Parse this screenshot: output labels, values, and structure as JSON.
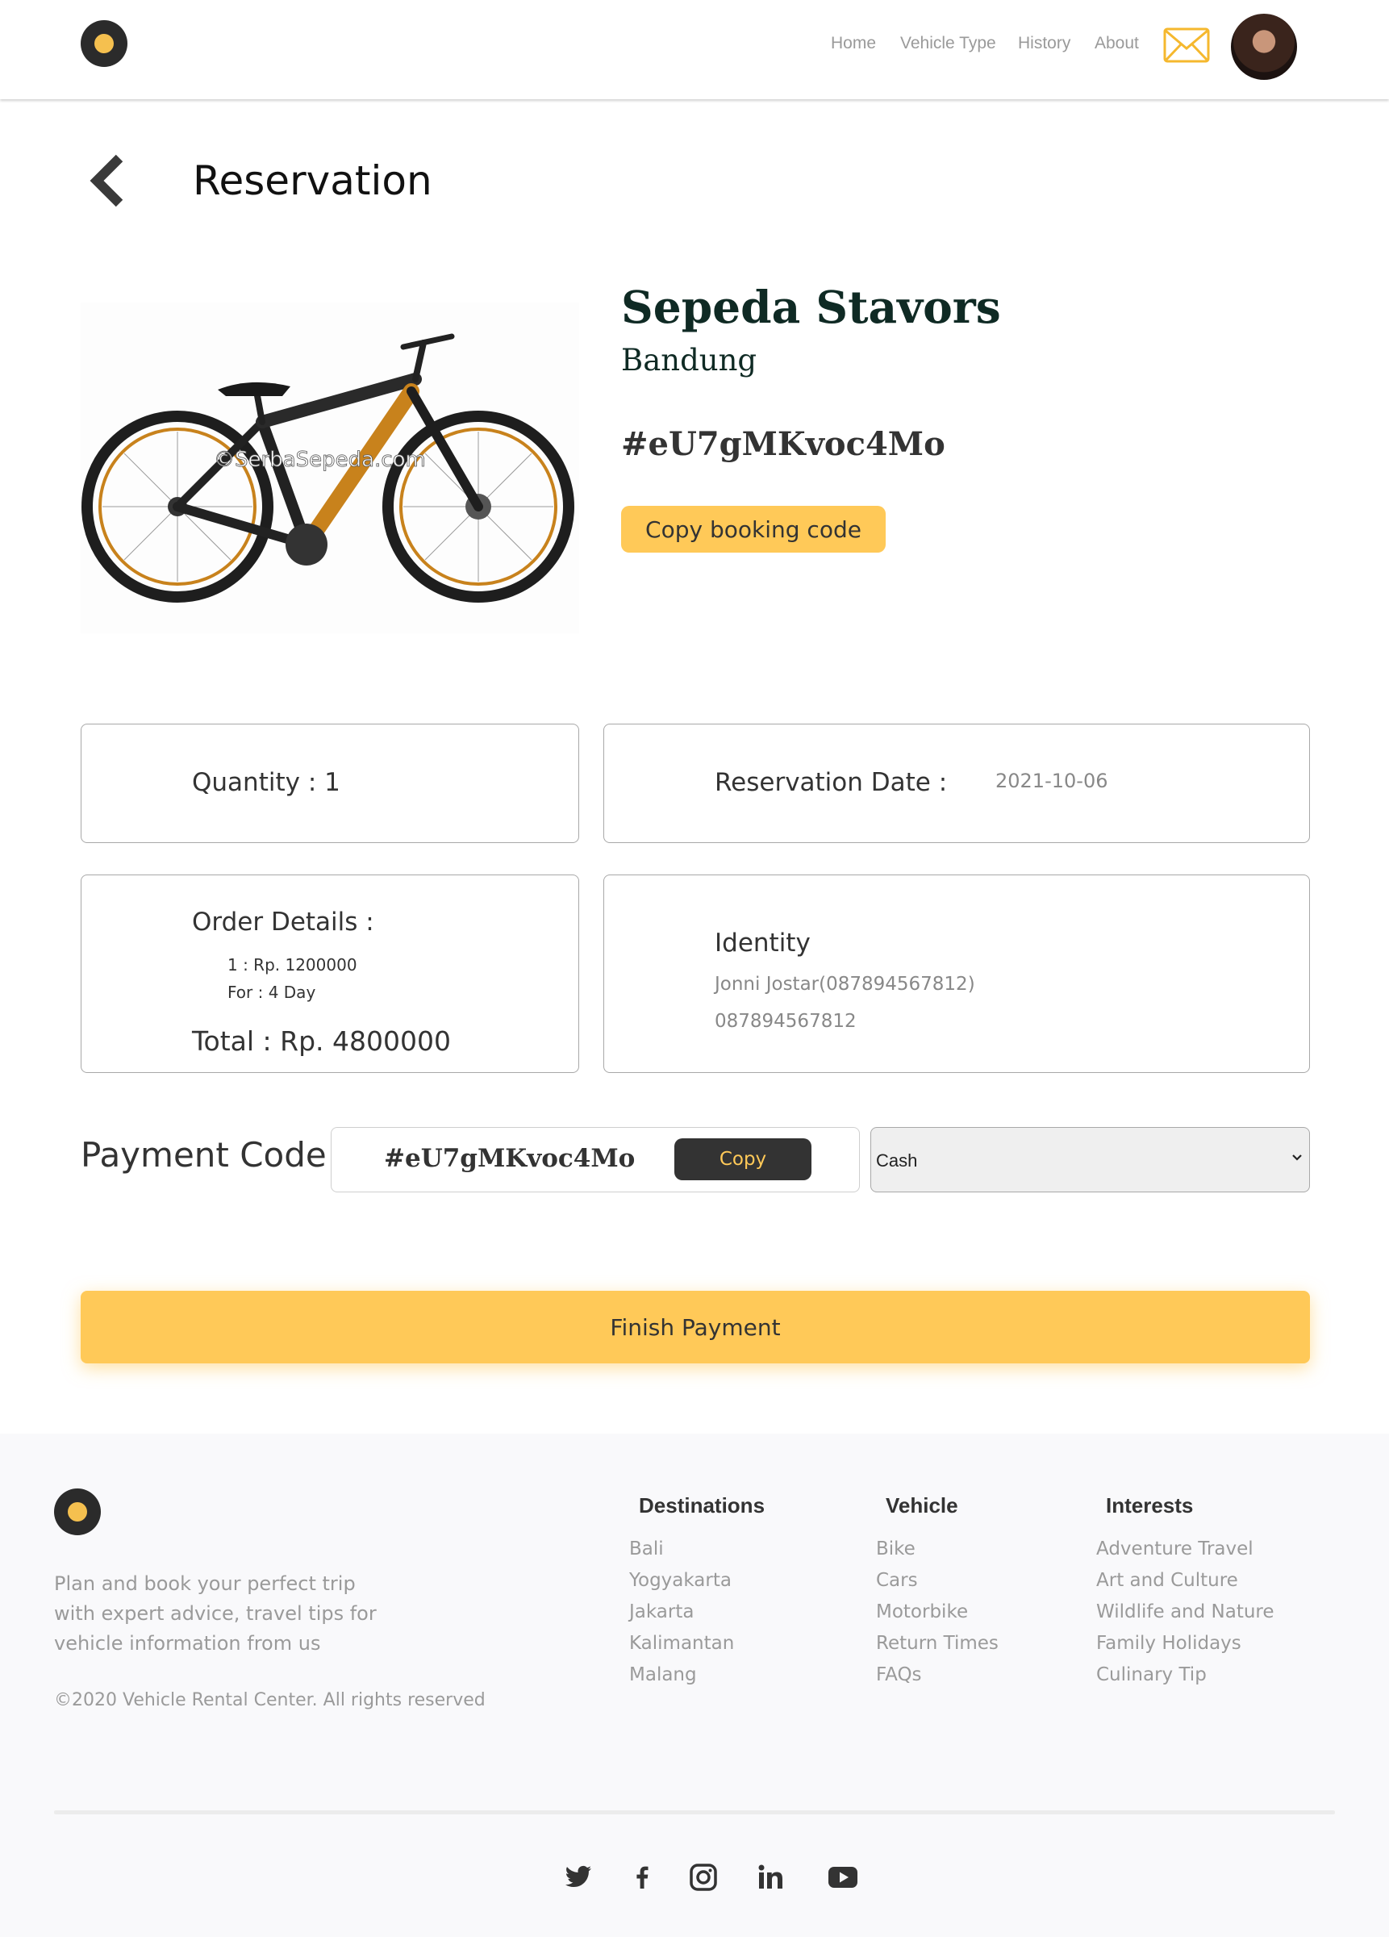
{
  "nav": {
    "links": [
      "Home",
      "Vehicle Type",
      "History",
      "About"
    ]
  },
  "page": {
    "title": "Reservation"
  },
  "vehicle": {
    "name": "Sepeda Stavors",
    "location": "Bandung",
    "booking_code": "#eU7gMKvoc4Mo",
    "copy_booking_label": "Copy booking code",
    "image_watermark": "©SerbaSepeda.com"
  },
  "quantity": {
    "text": "Quantity : 1"
  },
  "reservation": {
    "label": "Reservation Date :",
    "date": "2021-10-06"
  },
  "order": {
    "label": "Order Details :",
    "line1": "1 : Rp. 1200000",
    "line2": "For : 4 Day",
    "total": "Total : Rp. 4800000"
  },
  "identity": {
    "label": "Identity",
    "name": "Jonni Jostar(087894567812)",
    "phone": "087894567812"
  },
  "payment": {
    "label": "Payment Code :",
    "code": "#eU7gMKvoc4Mo",
    "copy_label": "Copy",
    "method": "Cash",
    "finish_label": "Finish Payment"
  },
  "footer": {
    "description": "Plan and book your perfect trip with expert advice, travel tips for vehicle information from us",
    "copyright": "©2020 Vehicle Rental Center. All rights reserved",
    "columns": [
      {
        "heading": "Destinations",
        "links": [
          "Bali",
          "Yogyakarta",
          "Jakarta",
          "Kalimantan",
          "Malang"
        ]
      },
      {
        "heading": "Vehicle",
        "links": [
          "Bike",
          "Cars",
          "Motorbike",
          "Return Times",
          "FAQs"
        ]
      },
      {
        "heading": "Interests",
        "links": [
          "Adventure Travel",
          "Art and Culture",
          "Wildlife and Nature",
          "Family Holidays",
          "Culinary Tip"
        ]
      }
    ],
    "social_icons": [
      "twitter-icon",
      "facebook-icon",
      "instagram-icon",
      "linkedin-icon",
      "youtube-icon"
    ]
  },
  "colors": {
    "accent": "#ffc958",
    "dark": "#333333"
  }
}
